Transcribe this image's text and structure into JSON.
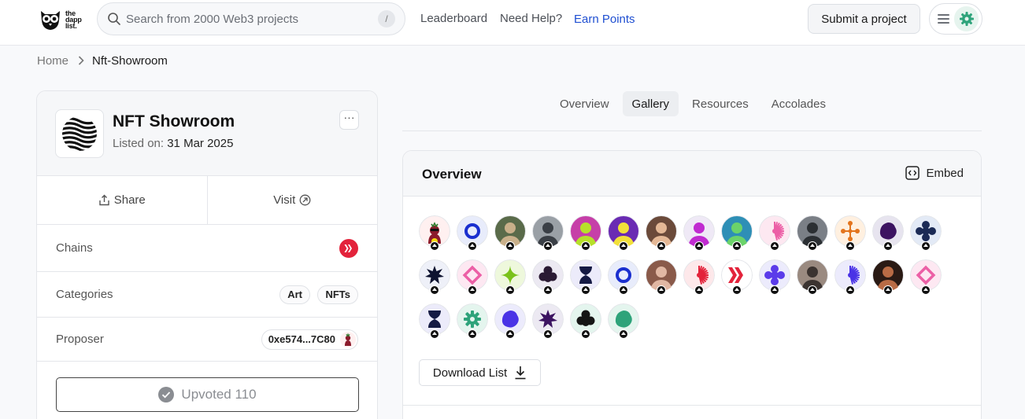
{
  "brand": {
    "line1": "the",
    "line2": "dapp",
    "line3": "list."
  },
  "search": {
    "placeholder": "Search from 2000 Web3 projects",
    "shortcut": "/"
  },
  "nav": {
    "leaderboard": "Leaderboard",
    "help": "Need Help?",
    "earn": "Earn Points"
  },
  "header": {
    "submit": "Submit a project"
  },
  "breadcrumb": {
    "home": "Home",
    "current": "Nft-Showroom"
  },
  "project": {
    "name": "NFT Showroom",
    "listed_label": "Listed on:",
    "listed_date": "31 Mar 2025",
    "share": "Share",
    "visit": "Visit",
    "chains_label": "Chains",
    "categories_label": "Categories",
    "categories": [
      "Art",
      "NFTs"
    ],
    "proposer_label": "Proposer",
    "proposer": "0xe574...7C80",
    "upvote": "Upvoted 110"
  },
  "tabs": [
    "Overview",
    "Gallery",
    "Resources",
    "Accolades"
  ],
  "active_tab": "Gallery",
  "panel": {
    "title": "Overview",
    "embed": "Embed",
    "download": "Download List"
  },
  "avatars": [
    {
      "icon": "character",
      "bg": "#fff0f0",
      "fg": "#8b1a2b"
    },
    {
      "icon": "ring",
      "bg": "#e8ecfb",
      "fg": "#1a2fcf"
    },
    {
      "icon": "photo",
      "bg": "#5a6b4a",
      "fg": "#c9b08a"
    },
    {
      "icon": "photo",
      "bg": "#9aa0a6",
      "fg": "#3a3f46"
    },
    {
      "icon": "photo",
      "bg": "#c63fa8",
      "fg": "#b7e02a"
    },
    {
      "icon": "photo",
      "bg": "#6a2bb3",
      "fg": "#f2e03a"
    },
    {
      "icon": "photo",
      "bg": "#6b4a3a",
      "fg": "#e4b896"
    },
    {
      "icon": "photo",
      "bg": "#efe9f6",
      "fg": "#c02bd0"
    },
    {
      "icon": "photo",
      "bg": "#2e8fb6",
      "fg": "#6bd36a"
    },
    {
      "icon": "burst",
      "bg": "#fde8f1",
      "fg": "#ec5fa6"
    },
    {
      "icon": "photo",
      "bg": "#7a7f86",
      "fg": "#2b2f33"
    },
    {
      "icon": "nodes",
      "bg": "#fff0e0",
      "fg": "#e3741d"
    },
    {
      "icon": "blob",
      "bg": "#e7e4ef",
      "fg": "#3c1361"
    },
    {
      "icon": "flower",
      "bg": "#e3eaf6",
      "fg": "#1b2a55"
    },
    {
      "icon": "star8",
      "bg": "#eef0f8",
      "fg": "#0e1330"
    },
    {
      "icon": "diamond",
      "bg": "#fde8f2",
      "fg": "#ec5fa6"
    },
    {
      "icon": "sparkle",
      "bg": "#eef8dc",
      "fg": "#7ac21a"
    },
    {
      "icon": "club",
      "bg": "#ece9f2",
      "fg": "#2a1a33"
    },
    {
      "icon": "hourglass",
      "bg": "#ecebfa",
      "fg": "#151a44"
    },
    {
      "icon": "ring",
      "bg": "#e8ecfb",
      "fg": "#1a2fcf"
    },
    {
      "icon": "photo",
      "bg": "#8a5a4a",
      "fg": "#e1b7a3"
    },
    {
      "icon": "burst",
      "bg": "#fde8ea",
      "fg": "#e3233b"
    },
    {
      "icon": "hive",
      "bg": "#ffffff",
      "fg": "#e3233b"
    },
    {
      "icon": "flower",
      "bg": "#ecebfc",
      "fg": "#5b3bea"
    },
    {
      "icon": "photo",
      "bg": "#9a8a80",
      "fg": "#3b3330"
    },
    {
      "icon": "burst",
      "bg": "#ecebfc",
      "fg": "#4a33e6"
    },
    {
      "icon": "photo",
      "bg": "#2a1a14",
      "fg": "#b86b45"
    },
    {
      "icon": "diamond",
      "bg": "#fde8f2",
      "fg": "#ec5fa6"
    },
    {
      "icon": "hourglass",
      "bg": "#ecebfa",
      "fg": "#151a44"
    },
    {
      "icon": "gear",
      "bg": "#e4f5ee",
      "fg": "#2ea37a"
    },
    {
      "icon": "blob",
      "bg": "#ecebfc",
      "fg": "#4a33e6"
    },
    {
      "icon": "star8",
      "bg": "#ece9f2",
      "fg": "#3c1361"
    },
    {
      "icon": "club",
      "bg": "#e4f5ee",
      "fg": "#151515"
    },
    {
      "icon": "blob",
      "bg": "#e4f5ee",
      "fg": "#2ea37a"
    }
  ],
  "colors": {
    "accent": "#1f4fd1",
    "hive_red": "#e3233b",
    "border": "#e4e6ea"
  }
}
